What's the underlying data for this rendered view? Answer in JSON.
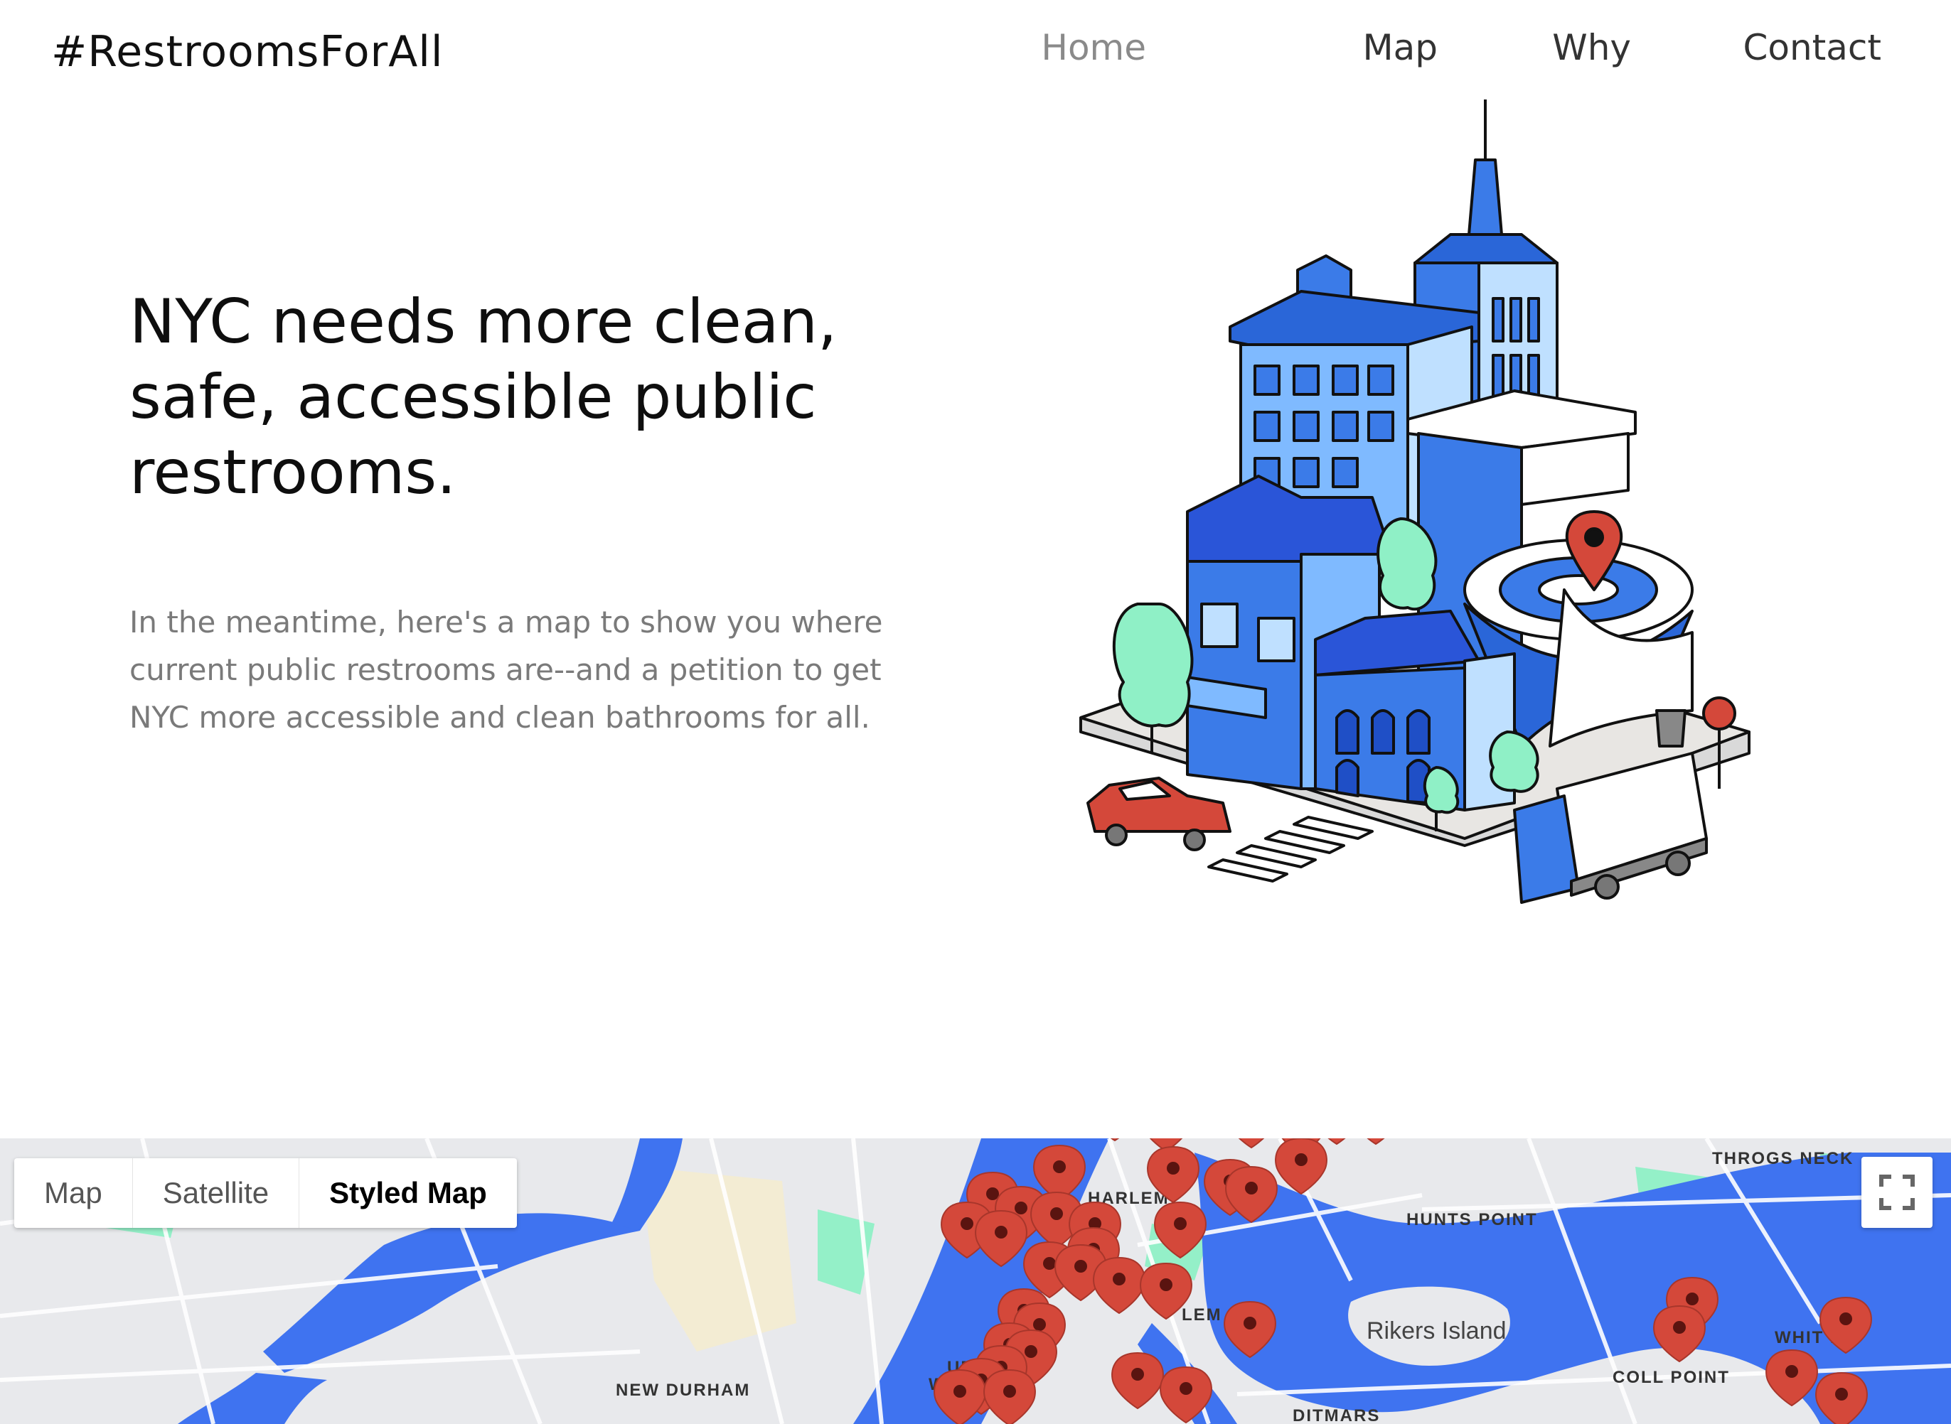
{
  "header": {
    "brand": "#RestroomsForAll",
    "nav": [
      {
        "label": "Home",
        "active": true
      },
      {
        "label": "Map",
        "active": false
      },
      {
        "label": "Why",
        "active": false
      },
      {
        "label": "Contact",
        "active": false
      }
    ]
  },
  "hero": {
    "title": "NYC needs more clean, safe, accessible public restrooms.",
    "text": "In the meantime, here's a map to show you where current public restrooms are--and a petition to get NYC more accessible and clean bathrooms for all."
  },
  "map": {
    "type_buttons": [
      {
        "label": "Map",
        "selected": false
      },
      {
        "label": "Satellite",
        "selected": false
      },
      {
        "label": "Styled Map",
        "selected": true
      }
    ],
    "fullscreen_icon": "fullscreen-icon",
    "labels": {
      "throgs_neck": "THROGS NECK",
      "harlem": "HARLEM",
      "hunts_point": "HUNTS POINT",
      "rikers": "Rikers Island",
      "lem": "LEM",
      "upper": "UPPER",
      "west": "WEST",
      "new_durham": "NEW DURHAM",
      "whitestone": "WHIT  NE",
      "college_point": "COLL     POINT",
      "ditmars": "DITMARS"
    },
    "colors": {
      "water": "#3f73f0",
      "park": "#8ff0c6",
      "land": "#e8e9ec",
      "marker": "#d4483a"
    }
  },
  "illustration": {
    "name": "city-restroom-illustration",
    "accent": "#3b7be8"
  }
}
